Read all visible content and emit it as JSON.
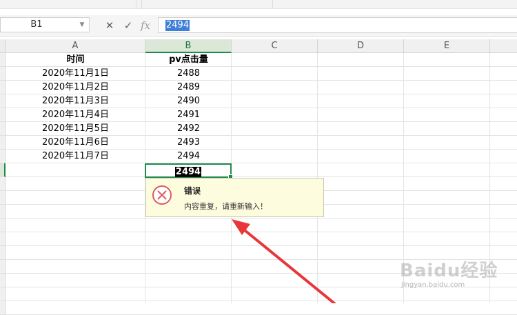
{
  "formula_bar": {
    "name_box": "B1",
    "cancel_icon": "✕",
    "confirm_icon": "✓",
    "fx_label": "fx",
    "value": "2494"
  },
  "columns": [
    "A",
    "B",
    "C",
    "D",
    "E"
  ],
  "table": {
    "headers": [
      "时间",
      "pv点击量"
    ],
    "rows": [
      [
        "2020年11月1日",
        "2488"
      ],
      [
        "2020年11月2日",
        "2489"
      ],
      [
        "2020年11月3日",
        "2490"
      ],
      [
        "2020年11月4日",
        "2491"
      ],
      [
        "2020年11月5日",
        "2492"
      ],
      [
        "2020年11月6日",
        "2493"
      ],
      [
        "2020年11月7日",
        "2494"
      ]
    ]
  },
  "active_cell": {
    "column": "B",
    "value": "2494"
  },
  "error_dialog": {
    "title": "错误",
    "message": "内容重复，请重新输入！",
    "icon": "error-x-icon"
  },
  "watermark": {
    "brand": "Baidu经验",
    "url": "jingyan.baidu.com"
  },
  "colors": {
    "accent_green": "#1f8a4c",
    "error_red": "#e05a5a",
    "selection_blue": "#3f7fd8",
    "annotation_arrow": "#e8363a",
    "tooltip_bg": "#fefcdf"
  }
}
